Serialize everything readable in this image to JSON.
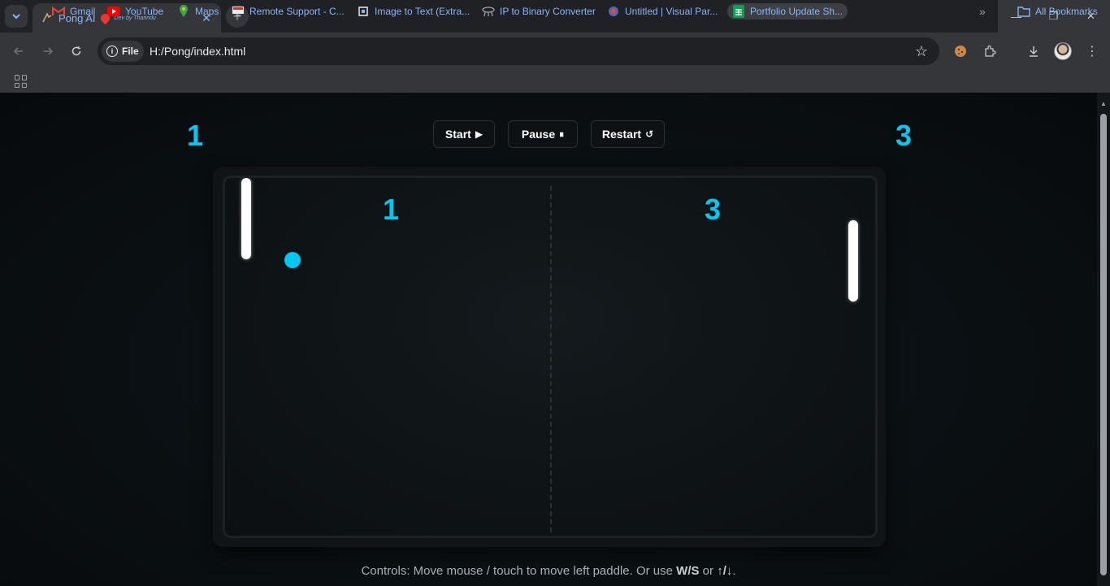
{
  "browser": {
    "tab": {
      "title": "Pong AI",
      "badge_text": "Dev by Tharindu",
      "close_glyph": "✕"
    },
    "window_controls": {
      "minimize": "—",
      "restore": "❐",
      "close": "✕"
    },
    "address": {
      "chip_label": "File",
      "url": "H:/Pong/index.html"
    },
    "bookmarks": [
      {
        "label": "Gmail",
        "icon": "gmail-icon"
      },
      {
        "label": "YouTube",
        "icon": "youtube-icon"
      },
      {
        "label": "Maps",
        "icon": "maps-icon"
      },
      {
        "label": "Remote Support - C...",
        "icon": "remote-support-icon"
      },
      {
        "label": "Image to Text (Extra...",
        "icon": "image-to-text-icon"
      },
      {
        "label": "IP to Binary Converter",
        "icon": "ip-converter-icon"
      },
      {
        "label": "Untitled | Visual Par...",
        "icon": "visual-paradigm-icon"
      },
      {
        "label": "Portfolio Update Sh...",
        "icon": "sheets-icon"
      }
    ],
    "overflow_glyph": "»",
    "all_bookmarks_label": "All Bookmarks"
  },
  "game": {
    "left_score": "1",
    "right_score": "3",
    "buttons": {
      "start": "Start",
      "start_glyph": "▶",
      "pause": "Pause",
      "pause_glyph": "⏸",
      "restart": "Restart",
      "restart_glyph": "↺"
    },
    "board_left_score": "1",
    "board_right_score": "3",
    "accent_color": "#00c8f0",
    "controls_prefix": "Controls: Move mouse / touch to move left paddle. Or use ",
    "controls_keys1": "W/S",
    "controls_mid": " or ",
    "controls_keys2": "↑/↓",
    "controls_suffix": "."
  }
}
